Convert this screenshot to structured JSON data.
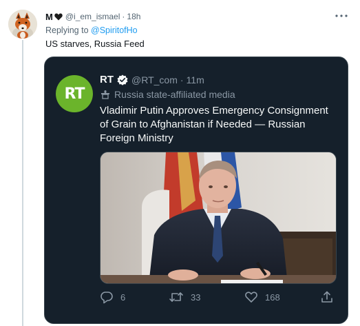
{
  "tweet": {
    "display_name": "M",
    "handle": "@i_em_ismael",
    "separator": "·",
    "time": "18h",
    "replying_prefix": "Replying to",
    "replying_to": "@SpiritofHo",
    "text": "US starves, Russia Feed"
  },
  "quoted_tweet": {
    "display_name": "RT",
    "handle": "@RT_com",
    "separator": "·",
    "time": "11m",
    "avatar_logo": "RT",
    "label": "Russia state-affiliated media",
    "text": "Vladimir Putin Approves Emergency Consignment of Grain to Afghanistan if Needed — Russian Foreign Ministry",
    "actions": {
      "replies": "6",
      "retweets": "33",
      "likes": "168"
    }
  },
  "icons": {
    "more": "more-horizontal-icon",
    "verified": "verified-badge-icon",
    "label": "podium-icon",
    "reply": "reply-icon",
    "retweet": "retweet-icon",
    "like": "heart-icon",
    "share": "share-icon"
  },
  "colors": {
    "accent": "#1d9bf0",
    "rt_brand": "#6bb42b",
    "quote_bg": "#15202b"
  }
}
